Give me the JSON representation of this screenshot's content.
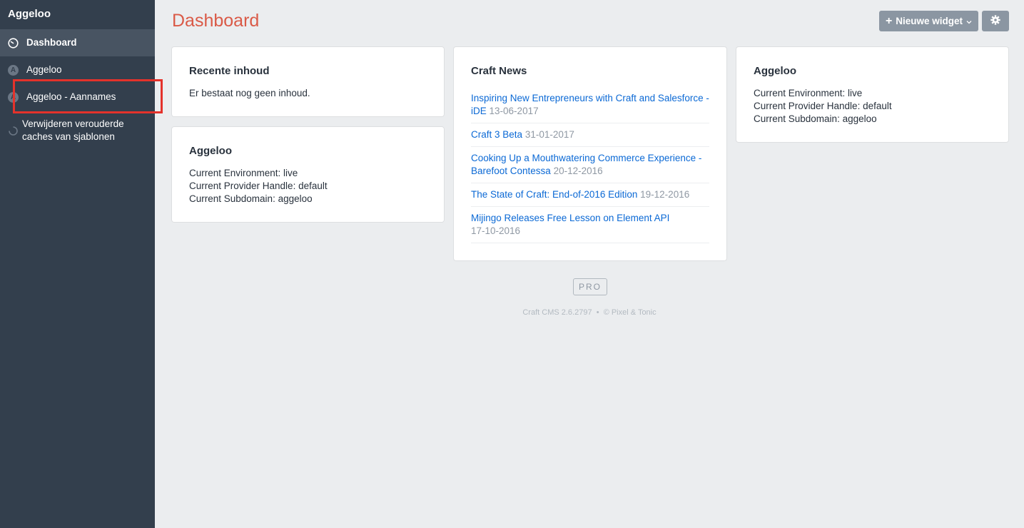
{
  "sidebar": {
    "site_name": "Aggeloo",
    "items": [
      {
        "label": "Dashboard",
        "icon": "dashboard-icon"
      },
      {
        "label": "Aggeloo",
        "icon": "aggeloo-plugin-icon",
        "letter": "A"
      },
      {
        "label": "Aggeloo - Aannames",
        "icon": "aggeloo-plugin-icon",
        "letter": "A"
      },
      {
        "label": "Verwijderen verouderde caches van sjablonen",
        "line1": "Verwijderen verouderde",
        "line2": "caches van sjablonen",
        "icon": "spinner-icon"
      }
    ]
  },
  "header": {
    "title": "Dashboard",
    "new_widget_label": "Nieuwe widget",
    "new_widget_icon": "plus-icon",
    "settings_icon": "gear-icon"
  },
  "widgets": {
    "recent": {
      "title": "Recente inhoud",
      "empty_text": "Er bestaat nog geen inhoud."
    },
    "aggeloo_1": {
      "title": "Aggeloo",
      "lines": [
        "Current Environment: live",
        "Current Provider Handle: default",
        "Current Subdomain: aggeloo"
      ]
    },
    "news": {
      "title": "Craft News",
      "items": [
        {
          "title": "Inspiring New Entrepreneurs with Craft and Salesforce - iDE",
          "date": "13-06-2017"
        },
        {
          "title": "Craft 3 Beta",
          "date": "31-01-2017"
        },
        {
          "title": "Cooking Up a Mouthwatering Commerce Experience - Barefoot Contessa",
          "date": "20-12-2016"
        },
        {
          "title": "The State of Craft: End-of-2016 Edition",
          "date": "19-12-2016"
        },
        {
          "title": "Mijingo Releases Free Lesson on Element API",
          "date": "17-10-2016"
        }
      ]
    },
    "aggeloo_2": {
      "title": "Aggeloo",
      "lines": [
        "Current Environment: live",
        "Current Provider Handle: default",
        "Current Subdomain: aggeloo"
      ]
    }
  },
  "footer": {
    "edition_badge": "PRO",
    "version_text": "Craft CMS 2.6.2797",
    "separator": "•",
    "copyright": "© Pixel & Tonic"
  },
  "colors": {
    "sidebar_bg": "#333f4d",
    "title_red": "#da5a47",
    "link_blue": "#0b69d5",
    "highlight": "#e4322b"
  }
}
